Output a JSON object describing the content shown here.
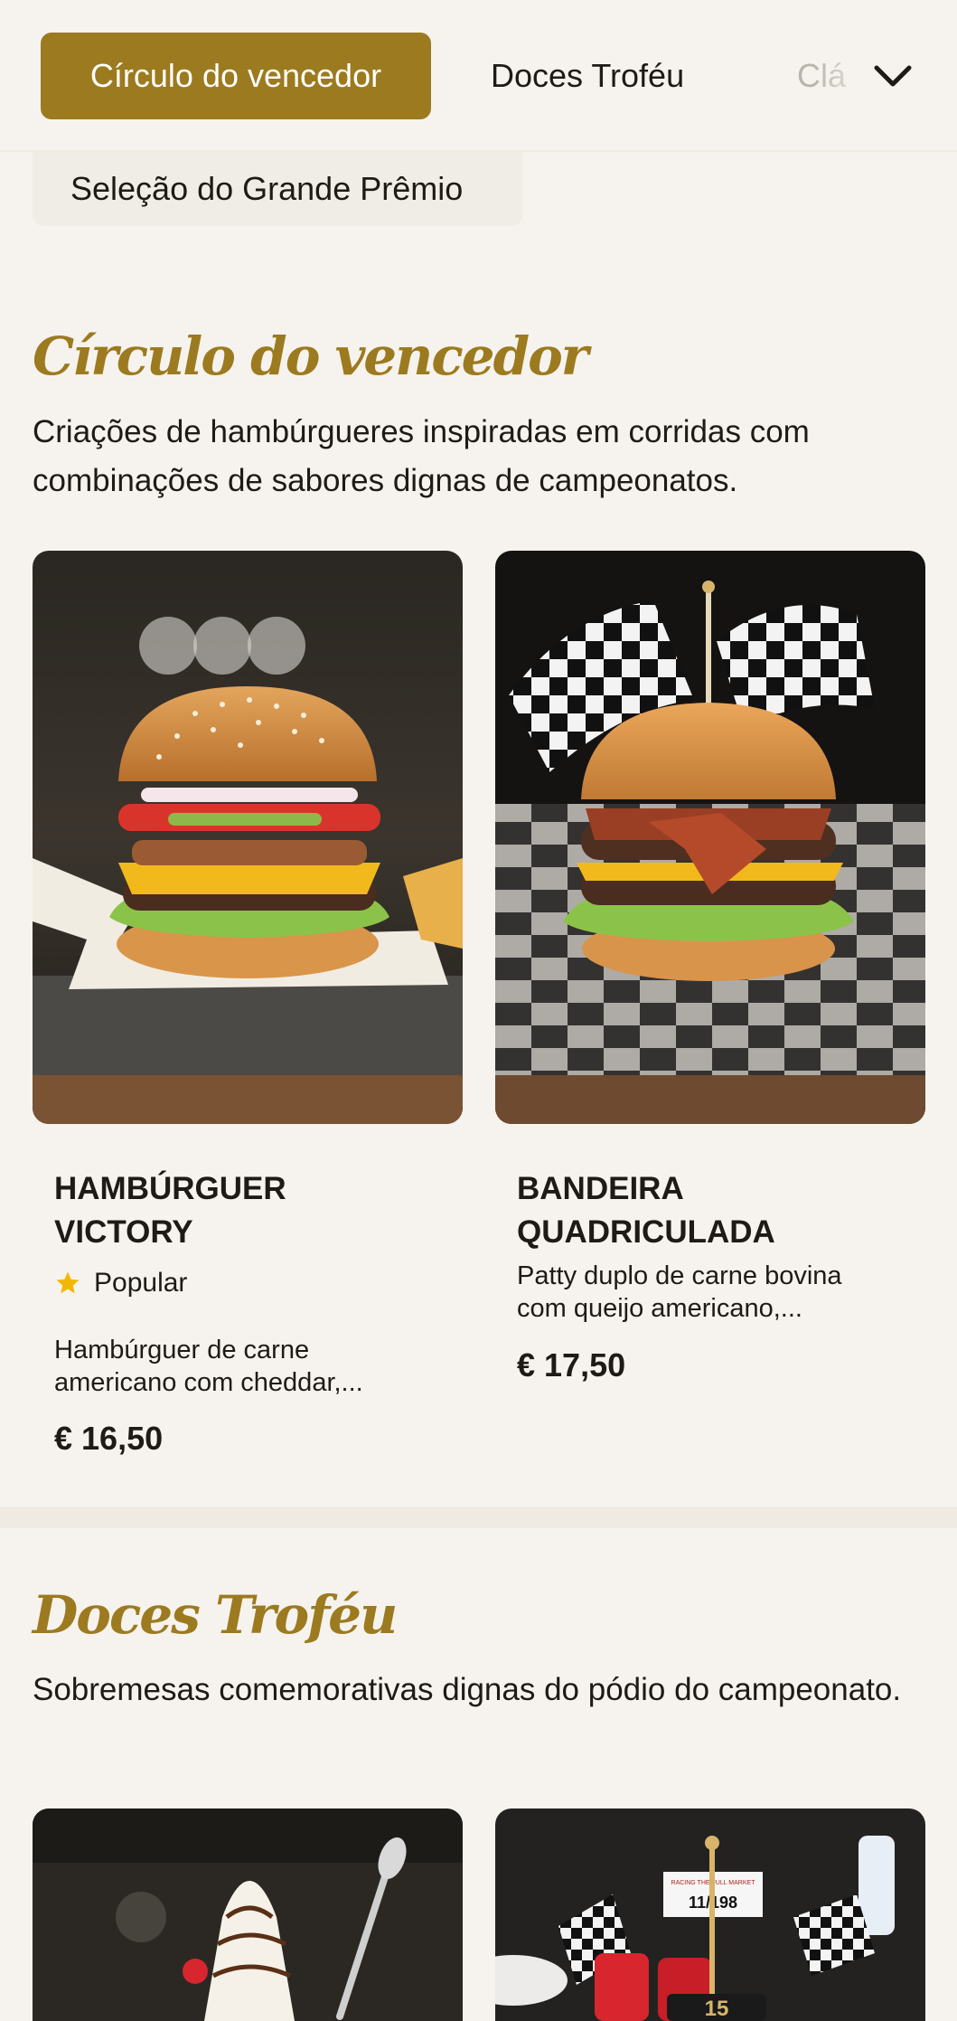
{
  "categories": {
    "active": "Círculo do vencedor",
    "tabs": [
      "Doces Troféu",
      "Clá"
    ],
    "extra": "Seleção do Grande Prêmio"
  },
  "sections": [
    {
      "title": "Círculo do vencedor",
      "description": "Criações de hambúrgueres inspiradas em corridas com combinações de sabores dignas de campeonatos.",
      "items": [
        {
          "name": "HAMBÚRGUER VICTORY",
          "badge": "Popular",
          "description": "Hambúrguer de carne americano com cheddar,...",
          "price": "€ 16,50"
        },
        {
          "name": "BANDEIRA QUADRICULADA",
          "description": "Patty duplo de carne bovina com queijo americano,...",
          "price": "€ 17,50"
        }
      ]
    },
    {
      "title": "Doces Troféu",
      "description": "Sobremesas comemorativas dignas do pódio do campeonato.",
      "image_texts": [
        "RACING THE FULL MARKET",
        "11/198",
        "15"
      ]
    }
  ],
  "colors": {
    "accent": "#9c7a1f",
    "background": "#f6f3ee",
    "star": "#f2b705"
  },
  "icons": [
    "chevron-down-icon",
    "star-icon"
  ]
}
